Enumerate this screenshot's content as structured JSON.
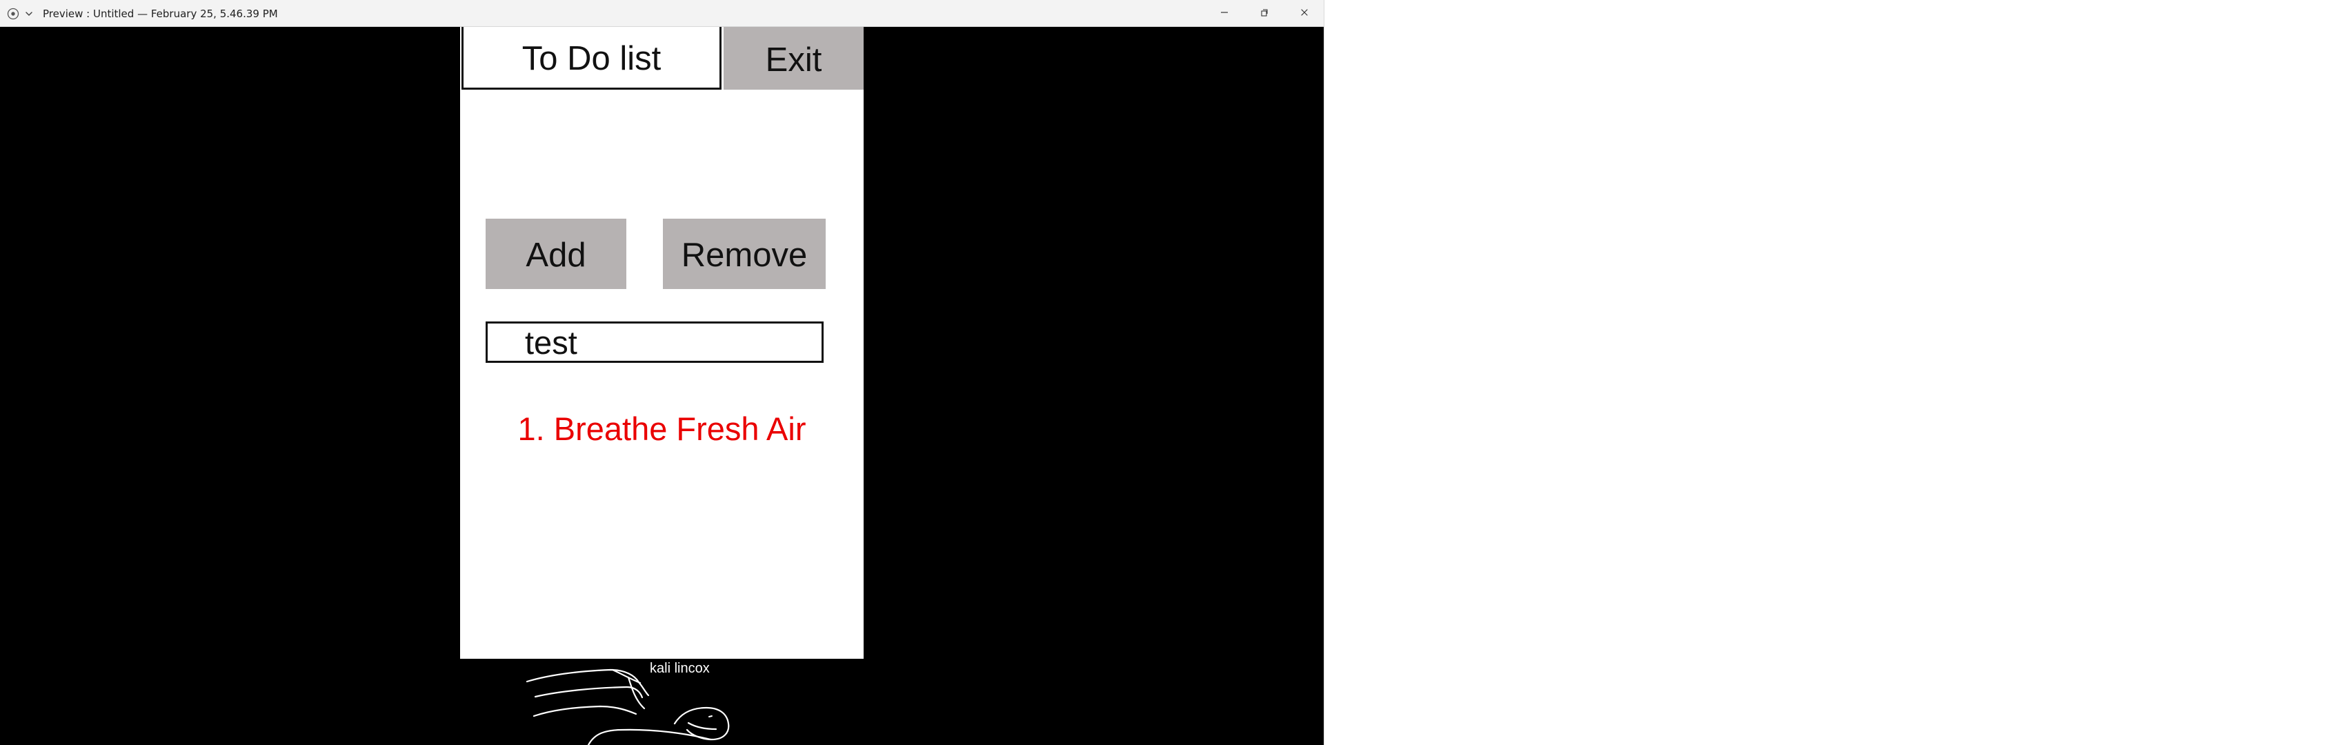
{
  "window": {
    "title": "Preview : Untitled — February 25, 5.46.39 PM",
    "background_color": "#000000",
    "titlebar_color": "#f3f3f3"
  },
  "icons": {
    "app_icon": "target-icon",
    "chevron": "chevron-down-icon",
    "minimize": "minimize-icon",
    "restore": "restore-icon",
    "close": "close-icon"
  },
  "tabs": {
    "todo_label": "To Do list",
    "exit_label": "Exit"
  },
  "actions": {
    "add_label": "Add",
    "remove_label": "Remove"
  },
  "input": {
    "value": "test"
  },
  "tasks": [
    {
      "label": "1. Breathe Fresh Air",
      "color": "#ea0000"
    }
  ],
  "signature": {
    "name": "kali lincox"
  },
  "colors": {
    "panel": "#ffffff",
    "button": "#b6b2b2",
    "text": "#111111",
    "task": "#ea0000"
  }
}
